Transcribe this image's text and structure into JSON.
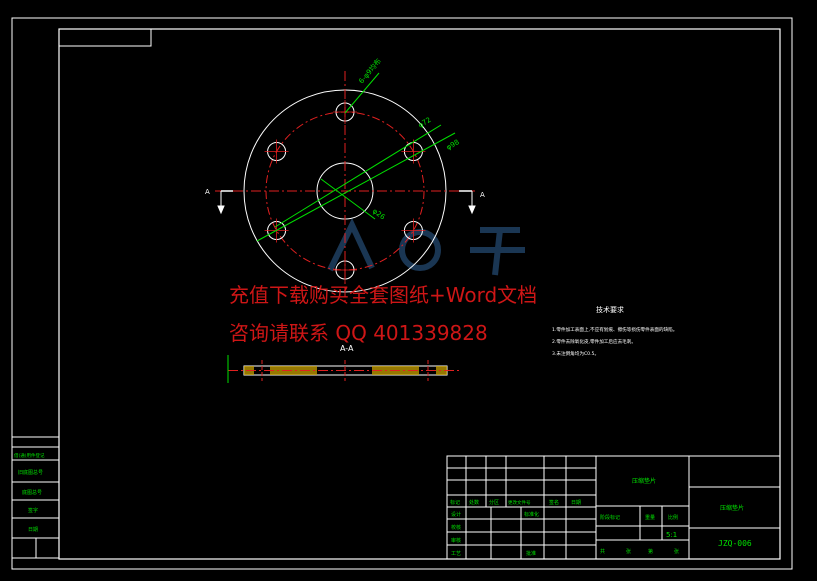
{
  "drawing": {
    "dim_holes": "6-φ9均布",
    "dim_pcd": "φ72",
    "dim_outer": "φ98",
    "dim_bore": "φ26",
    "section_mark": "A",
    "section_title": "A-A"
  },
  "tech_requirements": {
    "title": "技术要求",
    "lines": [
      "1.零件加工表面上,不应有划痕、擦伤等损伤零件表面的缺陷。",
      "2.零件去除氧化皮,零件加工后应去毛刺。",
      "3.未注倒角均为C0.5。"
    ]
  },
  "left_table": [
    "借(通)用件登记",
    "旧底图总号",
    "底图总号",
    "签字",
    "日期"
  ],
  "title_block": {
    "part_name": "压缩垫片",
    "drawing_number": "JZQ-006",
    "rev_headers": [
      "标记",
      "处数",
      "分区",
      "更改文件号",
      "签名",
      "日期"
    ],
    "role_labels": [
      "设计",
      "校核",
      "审核",
      "工艺"
    ],
    "mid_labels": [
      "标准化",
      "批准"
    ],
    "stage_headers": [
      "阶段标记",
      "重量",
      "比例"
    ],
    "scale": "5:1",
    "sheet_labels": [
      "共",
      "张",
      "第",
      "张"
    ]
  },
  "watermark": {
    "line1": "充值下载购买全套图纸+Word文档",
    "line2": "咨询请联系 QQ 401339828"
  }
}
